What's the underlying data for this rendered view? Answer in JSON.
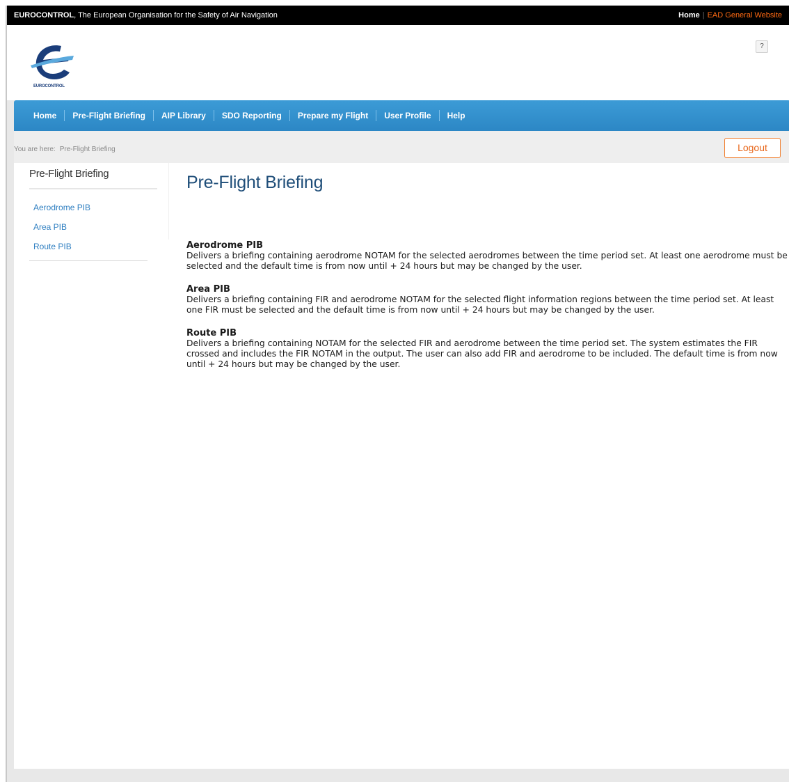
{
  "topbar": {
    "org_name": "EUROCONTROL",
    "org_tagline": ", The European Organisation for the Safety of Air Navigation",
    "home_link": "Home",
    "separator": "|",
    "ead_link": "EAD General Website"
  },
  "logo": {
    "text": "EUROCONTROL"
  },
  "nav": {
    "items": [
      "Home",
      "Pre-Flight Briefing",
      "AIP Library",
      "SDO Reporting",
      "Prepare my Flight",
      "User Profile",
      "Help"
    ]
  },
  "breadcrumb": {
    "prefix": "You are here:",
    "current": "Pre-Flight Briefing"
  },
  "logout_label": "Logout",
  "sidebar": {
    "title": "Pre-Flight Briefing",
    "items": [
      "Aerodrome PIB",
      "Area PIB",
      "Route PIB"
    ]
  },
  "main": {
    "title": "Pre-Flight Briefing",
    "help_label": "?",
    "sections": [
      {
        "heading": "Aerodrome PIB",
        "text": "Delivers a briefing containing aerodrome NOTAM for the selected aerodromes between the time period set. At least one aerodrome must be selected and the default time is from now until + 24 hours but may be changed by the user."
      },
      {
        "heading": "Area PIB",
        "text": "Delivers a briefing containing FIR and aerodrome NOTAM for the selected flight information regions between the time period set. At least one FIR must be selected and the default time is from now until + 24 hours but may be changed by the user."
      },
      {
        "heading": "Route PIB",
        "text": "Delivers a briefing containing NOTAM for the selected FIR and aerodrome between the time period set. The system estimates the FIR crossed and includes the FIR NOTAM in the output. The user can also add FIR and aerodrome to be included. The default time is from now until + 24 hours but may be changed by the user."
      }
    ]
  },
  "colors": {
    "nav_bg": "#2c87c5",
    "title": "#1f4e79",
    "link": "#2f7fc1",
    "accent_orange": "#f07d2c"
  }
}
